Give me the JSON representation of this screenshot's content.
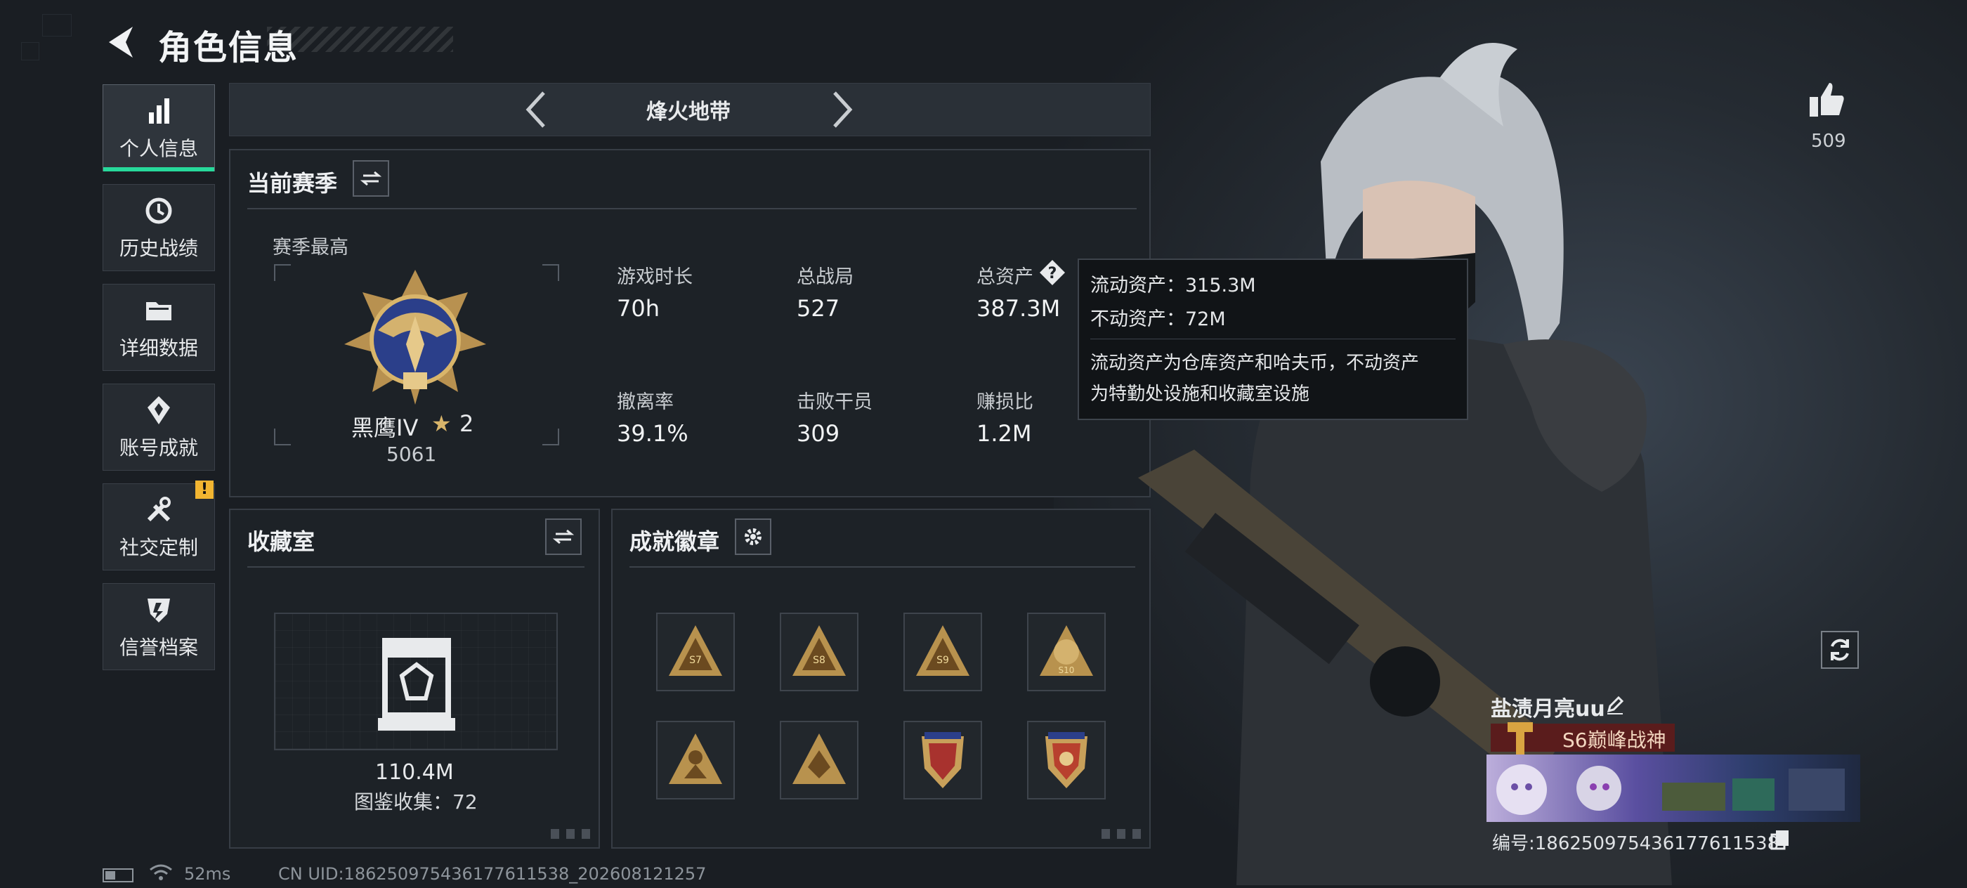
{
  "header": {
    "title": "角色信息"
  },
  "sidebar": {
    "items": [
      {
        "label": "个人信息",
        "icon": "bar-chart-icon",
        "active": true
      },
      {
        "label": "历史战绩",
        "icon": "history-clock-icon",
        "active": false
      },
      {
        "label": "详细数据",
        "icon": "folder-icon",
        "active": false
      },
      {
        "label": "账号成就",
        "icon": "achievement-icon",
        "active": false
      },
      {
        "label": "社交定制",
        "icon": "tools-icon",
        "active": false,
        "alert": "!"
      },
      {
        "label": "信誉档案",
        "icon": "credit-shield-icon",
        "active": false
      }
    ]
  },
  "mode": {
    "title": "烽火地带"
  },
  "season": {
    "title": "当前赛季",
    "best_label": "赛季最高",
    "rank_name": "黑鹰IV",
    "rank_stars": "2",
    "rank_points": "5061",
    "stats": [
      {
        "label": "游戏时长",
        "value": "70h"
      },
      {
        "label": "总战局",
        "value": "527"
      },
      {
        "label": "总资产",
        "value": "387.3M"
      },
      {
        "label": "撤离率",
        "value": "39.1%"
      },
      {
        "label": "击败干员",
        "value": "309"
      },
      {
        "label": "赚损比",
        "value": "1.2M"
      }
    ]
  },
  "tooltip": {
    "line1": "流动资产：315.3M",
    "line2": "不动资产：72M",
    "desc1": "流动资产为仓库资产和哈夫币，不动资产",
    "desc2": "为特勤处设施和收藏室设施"
  },
  "collection": {
    "title": "收藏室",
    "value": "110.4M",
    "count_text": "图鉴收集：72"
  },
  "achievements": {
    "title": "成就徽章",
    "badges": [
      "S7",
      "S8",
      "S9",
      "S10",
      "badge-5",
      "badge-6",
      "badge-7",
      "badge-8"
    ]
  },
  "player": {
    "likes": "509",
    "name": "盐渍月亮uu",
    "rank": "S6巅峰战神",
    "uid_text": "编号:186250975436177611538"
  },
  "status": {
    "ping": "52ms",
    "uid_line": "CN UID:186250975436177611538_202608121257"
  },
  "colors": {
    "accent": "#27d99b",
    "alert": "#f2b531",
    "panel_bg": "#1d2227",
    "rank_bg": "#5a1c1c"
  }
}
